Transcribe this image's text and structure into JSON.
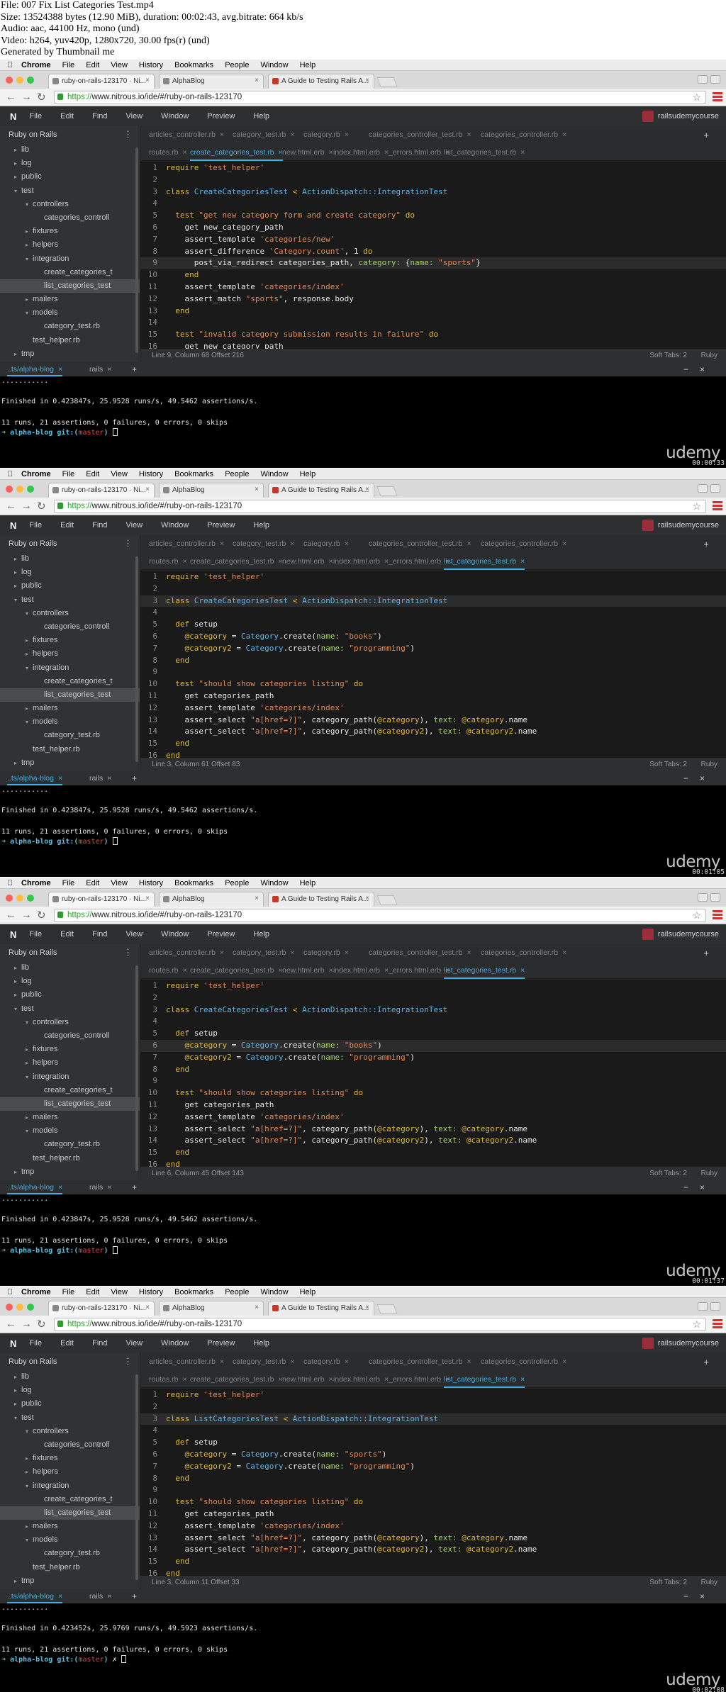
{
  "header": {
    "lines": [
      "File: 007 Fix List Categories Test.mp4",
      "Size: 13524388 bytes (12.90 MiB), duration: 00:02:43, avg.bitrate: 664 kb/s",
      "Audio: aac, 44100 Hz, mono (und)",
      "Video: h264, yuv420p, 1280x720, 30.00 fps(r) (und)",
      "Generated by Thumbnail me"
    ]
  },
  "mac_menu": [
    "Chrome",
    "File",
    "Edit",
    "View",
    "History",
    "Bookmarks",
    "People",
    "Window",
    "Help"
  ],
  "browser_tabs": [
    "ruby-on-rails-123170 · Ni...",
    "AlphaBlog",
    "A Guide to Testing Rails A..."
  ],
  "url": {
    "prefix": "https://",
    "rest": "www.nitrous.io/ide/#/ruby-on-rails-123170"
  },
  "ide_menu": {
    "logo": "N",
    "items": [
      "File",
      "Edit",
      "Find",
      "View",
      "Window",
      "Preview",
      "Help"
    ],
    "user": "railsudemycourse"
  },
  "sidebar": {
    "title": "Ruby on Rails",
    "items": [
      {
        "label": "lib",
        "indent": 2,
        "arrow": "▸",
        "sel": false
      },
      {
        "label": "log",
        "indent": 2,
        "arrow": "▸",
        "sel": false
      },
      {
        "label": "public",
        "indent": 2,
        "arrow": "▸",
        "sel": false
      },
      {
        "label": "test",
        "indent": 2,
        "arrow": "▾",
        "sel": false
      },
      {
        "label": "controllers",
        "indent": 3,
        "arrow": "▾",
        "sel": false
      },
      {
        "label": "categories_controll",
        "indent": 4,
        "arrow": "",
        "sel": false
      },
      {
        "label": "fixtures",
        "indent": 3,
        "arrow": "▸",
        "sel": false
      },
      {
        "label": "helpers",
        "indent": 3,
        "arrow": "▸",
        "sel": false
      },
      {
        "label": "integration",
        "indent": 3,
        "arrow": "▾",
        "sel": false
      },
      {
        "label": "create_categories_t",
        "indent": 4,
        "arrow": "",
        "sel": false
      },
      {
        "label": "list_categories_test",
        "indent": 4,
        "arrow": "",
        "sel": true
      },
      {
        "label": "mailers",
        "indent": 3,
        "arrow": "▸",
        "sel": false
      },
      {
        "label": "models",
        "indent": 3,
        "arrow": "▾",
        "sel": false
      },
      {
        "label": "category_test.rb",
        "indent": 4,
        "arrow": "",
        "sel": false
      },
      {
        "label": "test_helper.rb",
        "indent": 3,
        "arrow": "",
        "sel": false
      },
      {
        "label": "tmp",
        "indent": 2,
        "arrow": "▸",
        "sel": false
      }
    ]
  },
  "editor_tabs_row1": [
    "articles_controller.rb",
    "category_test.rb",
    "category.rb",
    "categories_controller_test.rb",
    "categories_controller.rb"
  ],
  "editor_tabs_row2": [
    "routes.rb",
    "create_categories_test.rb",
    "new.html.erb",
    "index.html.erb",
    "_errors.html.erb",
    "list_categories_test.rb"
  ],
  "terminal_tabs": [
    "..ts/alpha-blog",
    "rails"
  ],
  "brand": "udemy",
  "frames": [
    {
      "active_tab": "create_categories_test.rb",
      "status": "Line 9, Column 68 Offset 216",
      "soft_tabs": "Soft Tabs: 2",
      "lang": "Ruby",
      "highlight_line": 9,
      "code_lines": [
        "require 'test_helper'",
        "",
        "class CreateCategoriesTest < ActionDispatch::IntegrationTest",
        "",
        "  test \"get new category form and create category\" do",
        "    get new_category_path",
        "    assert_template 'categories/new'",
        "    assert_difference 'Category.count', 1 do",
        "      post_via_redirect categories_path, category: {name: \"sports\"}",
        "    end",
        "    assert_template 'categories/index'",
        "    assert_match \"sports\", response.body",
        "  end",
        "",
        "  test \"invalid category submission results in failure\" do",
        "    get new_category_path"
      ],
      "terminal": [
        "...........",
        "",
        "Finished in 0.423847s, 25.9528 runs/s, 49.5462 assertions/s.",
        "",
        "11 runs, 21 assertions, 0 failures, 0 errors, 0 skips"
      ],
      "prompt": {
        "arrow": "➜",
        "dir": "alpha-blog",
        "git": "git:(",
        "branch": "master",
        "close": ")",
        "tail": ""
      },
      "timestamp": "00:00:33"
    },
    {
      "active_tab": "list_categories_test.rb",
      "status": "Line 3, Column 61 Offset 83",
      "soft_tabs": "Soft Tabs: 2",
      "lang": "Ruby",
      "highlight_line": 3,
      "code_lines": [
        "require 'test_helper'",
        "",
        "class CreateCategoriesTest < ActionDispatch::IntegrationTest",
        "",
        "  def setup",
        "    @category = Category.create(name: \"books\")",
        "    @category2 = Category.create(name: \"programming\")",
        "  end",
        "",
        "  test \"should show categories listing\" do",
        "    get categories_path",
        "    assert_template 'categories/index'",
        "    assert_select \"a[href=?]\", category_path(@category), text: @category.name",
        "    assert_select \"a[href=?]\", category_path(@category2), text: @category2.name",
        "  end",
        "end"
      ],
      "terminal": [
        "...........",
        "",
        "Finished in 0.423847s, 25.9528 runs/s, 49.5462 assertions/s.",
        "",
        "11 runs, 21 assertions, 0 failures, 0 errors, 0 skips"
      ],
      "prompt": {
        "arrow": "➜",
        "dir": "alpha-blog",
        "git": "git:(",
        "branch": "master",
        "close": ")",
        "tail": ""
      },
      "timestamp": "00:01:05"
    },
    {
      "active_tab": "list_categories_test.rb",
      "status": "Line 6, Column 45 Offset 143",
      "soft_tabs": "Soft Tabs: 2",
      "lang": "Ruby",
      "highlight_line": 6,
      "code_lines": [
        "require 'test_helper'",
        "",
        "class CreateCategoriesTest < ActionDispatch::IntegrationTest",
        "",
        "  def setup",
        "    @category = Category.create(name: \"books\")",
        "    @category2 = Category.create(name: \"programming\")",
        "  end",
        "",
        "  test \"should show categories listing\" do",
        "    get categories_path",
        "    assert_template 'categories/index'",
        "    assert_select \"a[href=?]\", category_path(@category), text: @category.name",
        "    assert_select \"a[href=?]\", category_path(@category2), text: @category2.name",
        "  end",
        "end"
      ],
      "terminal": [
        "...........",
        "",
        "Finished in 0.423847s, 25.9528 runs/s, 49.5462 assertions/s.",
        "",
        "11 runs, 21 assertions, 0 failures, 0 errors, 0 skips"
      ],
      "prompt": {
        "arrow": "➜",
        "dir": "alpha-blog",
        "git": "git:(",
        "branch": "master",
        "close": ")",
        "tail": ""
      },
      "timestamp": "00:01:37"
    },
    {
      "active_tab": "list_categories_test.rb",
      "status": "Line 3, Column 11 Offset 33",
      "soft_tabs": "Soft Tabs: 2",
      "lang": "Ruby",
      "highlight_line": 3,
      "code_lines": [
        "require 'test_helper'",
        "",
        "class ListCategoriesTest < ActionDispatch::IntegrationTest",
        "",
        "  def setup",
        "    @category = Category.create(name: \"sports\")",
        "    @category2 = Category.create(name: \"programming\")",
        "  end",
        "",
        "  test \"should show categories listing\" do",
        "    get categories_path",
        "    assert_template 'categories/index'",
        "    assert_select \"a[href=?]\", category_path(@category), text: @category.name",
        "    assert_select \"a[href=?]\", category_path(@category2), text: @category2.name",
        "  end",
        "end"
      ],
      "terminal": [
        "...........",
        "",
        "Finished in 0.423452s, 25.9769 runs/s, 49.5923 assertions/s.",
        "",
        "11 runs, 21 assertions, 0 failures, 0 errors, 0 skips"
      ],
      "prompt": {
        "arrow": "➜",
        "dir": "alpha-blog",
        "git": "git:(",
        "branch": "master",
        "close": ")",
        "tail": " ✗"
      },
      "timestamp": "00:02:08"
    }
  ]
}
